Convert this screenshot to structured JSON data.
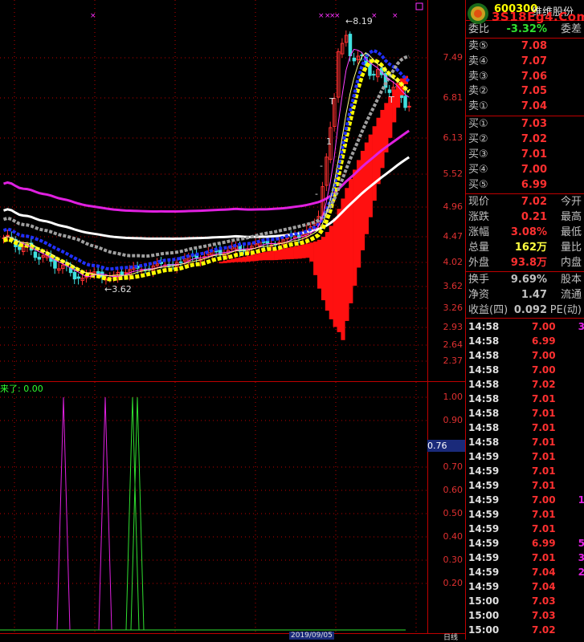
{
  "header": {
    "stock_code": "600300",
    "stock_name": "维维股份",
    "watermark": "3S18Eg4.Com"
  },
  "price_axis": {
    "ticks": [
      {
        "label": "7.49",
        "value": 7.49
      },
      {
        "label": "6.81",
        "value": 6.81
      },
      {
        "label": "6.13",
        "value": 6.13
      },
      {
        "label": "5.52",
        "value": 5.52
      },
      {
        "label": "4.96",
        "value": 4.96
      },
      {
        "label": "4.47",
        "value": 4.47
      },
      {
        "label": "4.02",
        "value": 4.02
      },
      {
        "label": "3.62",
        "value": 3.62
      },
      {
        "label": "3.26",
        "value": 3.26
      },
      {
        "label": "2.93",
        "value": 2.93
      },
      {
        "label": "2.64",
        "value": 2.64
      },
      {
        "label": "2.37",
        "value": 2.37
      }
    ]
  },
  "main_chart": {
    "high_label": "8.19",
    "low_label": "3.62",
    "markers": [
      "T",
      "T",
      "1",
      "-",
      "-"
    ]
  },
  "indicator": {
    "label": "来了: 0.00",
    "current_value": "0.76",
    "ticks": [
      {
        "label": "1.00",
        "value": 1.0
      },
      {
        "label": "0.90",
        "value": 0.9
      },
      {
        "label": "0.70",
        "value": 0.7
      },
      {
        "label": "0.60",
        "value": 0.6
      },
      {
        "label": "0.50",
        "value": 0.5
      },
      {
        "label": "0.40",
        "value": 0.4
      },
      {
        "label": "0.30",
        "value": 0.3
      },
      {
        "label": "0.20",
        "value": 0.2
      }
    ]
  },
  "bottom_bar": {
    "date_label": "2019/09/05",
    "period_label": "日线"
  },
  "panel": {
    "webi": {
      "label": "委比",
      "value": "-3.32%",
      "right": "委差"
    },
    "asks": [
      {
        "label": "卖⑤",
        "price": "7.08"
      },
      {
        "label": "卖④",
        "price": "7.07"
      },
      {
        "label": "卖③",
        "price": "7.06"
      },
      {
        "label": "卖②",
        "price": "7.05"
      },
      {
        "label": "卖①",
        "price": "7.04"
      }
    ],
    "bids": [
      {
        "label": "买①",
        "price": "7.03"
      },
      {
        "label": "买②",
        "price": "7.02"
      },
      {
        "label": "买③",
        "price": "7.01"
      },
      {
        "label": "买④",
        "price": "7.00"
      },
      {
        "label": "买⑤",
        "price": "6.99"
      }
    ],
    "quote": [
      {
        "label": "现价",
        "value": "7.02",
        "right": "今开",
        "color": "red"
      },
      {
        "label": "涨跌",
        "value": "0.21",
        "right": "最高",
        "color": "red"
      },
      {
        "label": "涨幅",
        "value": "3.08%",
        "right": "最低",
        "color": "red"
      },
      {
        "label": "总量",
        "value": "162万",
        "right": "量比",
        "color": "yel"
      },
      {
        "label": "外盘",
        "value": "93.8万",
        "right": "内盘",
        "color": "red"
      }
    ],
    "stats": [
      {
        "label": "换手",
        "value": "9.69%",
        "right": "股本"
      },
      {
        "label": "净资",
        "value": "1.47",
        "right": "流通"
      },
      {
        "label": "收益(四)",
        "value": "0.092",
        "right": "PE(动)"
      }
    ],
    "trades": [
      {
        "time": "14:58",
        "price": "7.00",
        "vol": "3",
        "color": "red"
      },
      {
        "time": "14:58",
        "price": "6.99",
        "vol": "",
        "color": "red"
      },
      {
        "time": "14:58",
        "price": "7.00",
        "vol": "",
        "color": "red"
      },
      {
        "time": "14:58",
        "price": "7.00",
        "vol": "",
        "color": "red"
      },
      {
        "time": "14:58",
        "price": "7.02",
        "vol": "",
        "color": "red"
      },
      {
        "time": "14:58",
        "price": "7.01",
        "vol": "",
        "color": "red"
      },
      {
        "time": "14:58",
        "price": "7.01",
        "vol": "",
        "color": "red"
      },
      {
        "time": "14:58",
        "price": "7.01",
        "vol": "",
        "color": "red"
      },
      {
        "time": "14:58",
        "price": "7.01",
        "vol": "",
        "color": "red"
      },
      {
        "time": "14:59",
        "price": "7.01",
        "vol": "",
        "color": "red"
      },
      {
        "time": "14:59",
        "price": "7.01",
        "vol": "",
        "color": "red"
      },
      {
        "time": "14:59",
        "price": "7.01",
        "vol": "",
        "color": "red"
      },
      {
        "time": "14:59",
        "price": "7.00",
        "vol": "1",
        "color": "red"
      },
      {
        "time": "14:59",
        "price": "7.01",
        "vol": "",
        "color": "red"
      },
      {
        "time": "14:59",
        "price": "7.01",
        "vol": "",
        "color": "red"
      },
      {
        "time": "14:59",
        "price": "6.99",
        "vol": "5",
        "color": "red"
      },
      {
        "time": "14:59",
        "price": "7.01",
        "vol": "3",
        "color": "red"
      },
      {
        "time": "14:59",
        "price": "7.04",
        "vol": "2",
        "color": "red"
      },
      {
        "time": "14:59",
        "price": "7.04",
        "vol": "",
        "color": "red"
      },
      {
        "time": "15:00",
        "price": "7.03",
        "vol": "",
        "color": "red"
      },
      {
        "time": "15:00",
        "price": "7.03",
        "vol": "",
        "color": "red"
      },
      {
        "time": "15:00",
        "price": "7.02",
        "vol": "",
        "color": "red"
      }
    ]
  },
  "colors": {
    "up": "#ff3030",
    "down": "#40e0e0",
    "grid": "#c00000",
    "ma_magenta": "#e020e0",
    "ma_white": "#ffffff",
    "ma_yellow": "#ffff00",
    "ma_blue": "#2030ff",
    "ma_gray": "#a0a0a0"
  }
}
